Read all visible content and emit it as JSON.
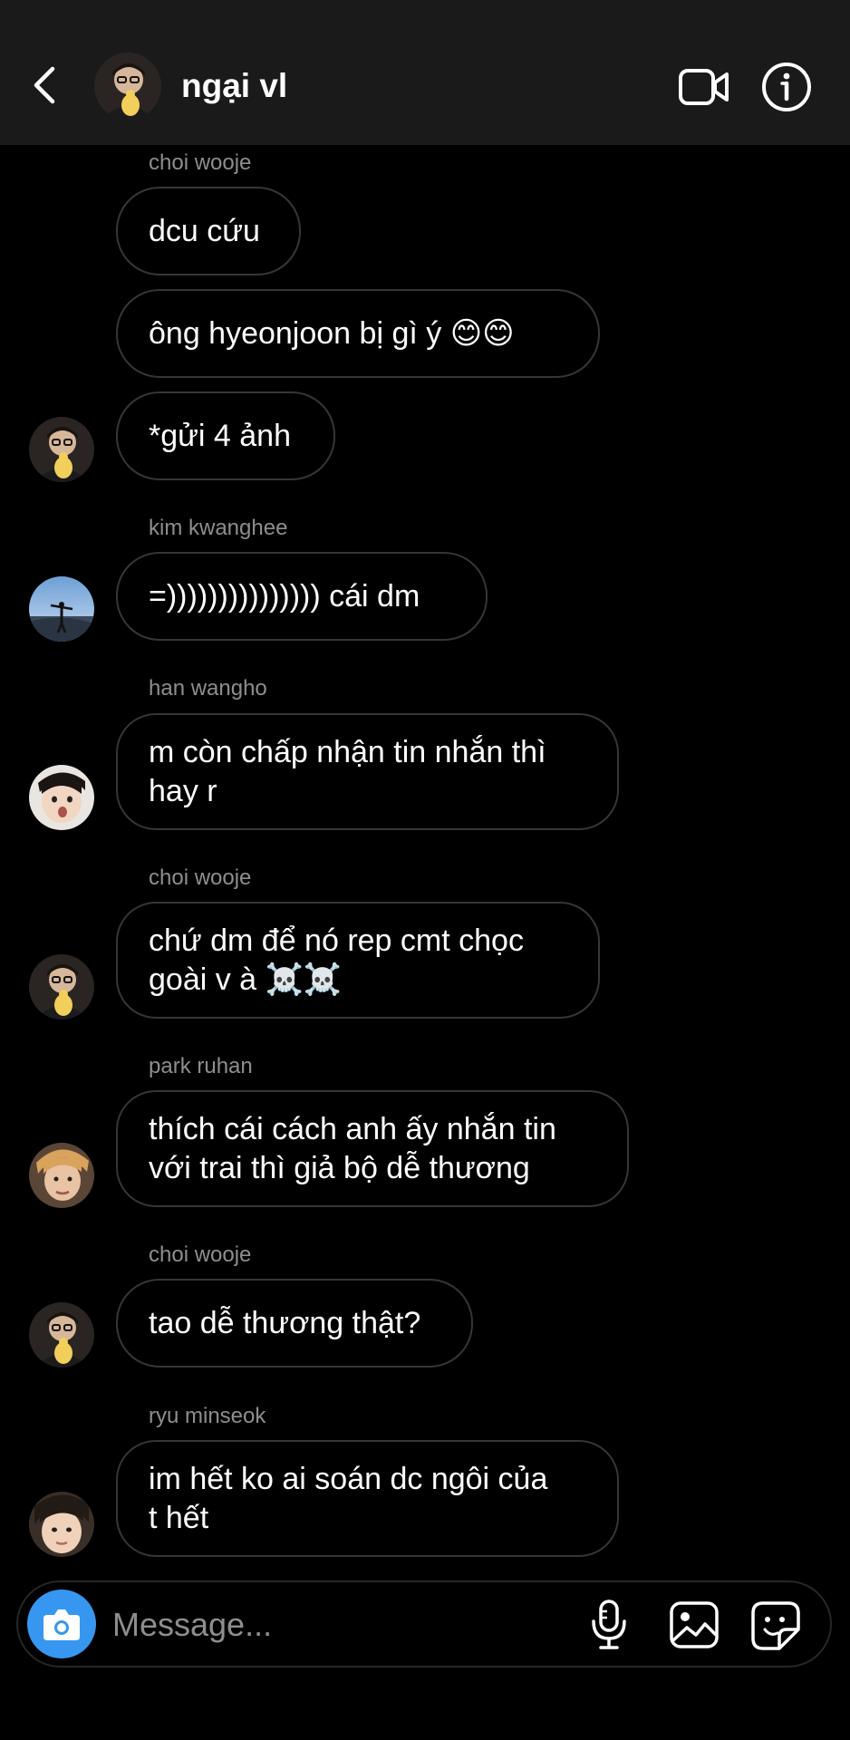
{
  "header": {
    "title": "ngại vl",
    "back_icon": "chevron-left-icon",
    "video_icon": "video-camera-icon",
    "info_icon": "info-icon"
  },
  "messages": [
    {
      "sender": "choi wooje",
      "lines": [
        "dcu cứu"
      ]
    },
    {
      "lines": [
        "ông hyeonjoon bị gì ý 😊😊"
      ]
    },
    {
      "lines": [
        "*gửi 4 ảnh"
      ]
    },
    {
      "sender": "kim kwanghee",
      "lines": [
        "=))))))))))))))) cái dm"
      ]
    },
    {
      "sender": "han wangho",
      "lines": [
        "m còn chấp nhận tin nhắn thì",
        "hay r"
      ]
    },
    {
      "sender": "choi wooje",
      "lines": [
        "chứ dm để nó rep cmt chọc",
        "goài v à ☠️☠️"
      ]
    },
    {
      "sender": "park ruhan",
      "lines": [
        "thích cái cách anh ấy nhắn tin",
        "với trai thì giả bộ dễ thương"
      ]
    },
    {
      "sender": "choi wooje",
      "lines": [
        "tao dễ thương thật?"
      ]
    },
    {
      "sender": "ryu minseok",
      "lines": [
        "im hết ko ai soán dc ngôi của",
        "t hết"
      ]
    }
  ],
  "composer": {
    "placeholder": "Message...",
    "camera_icon": "camera-icon",
    "mic_icon": "microphone-icon",
    "gallery_icon": "gallery-icon",
    "sticker_icon": "sticker-icon"
  },
  "colors": {
    "background": "#000000",
    "header_bg": "#1a1a1a",
    "bubble_border": "#363636",
    "secondary_text": "#8e8e8e",
    "accent": "#3797f0"
  }
}
